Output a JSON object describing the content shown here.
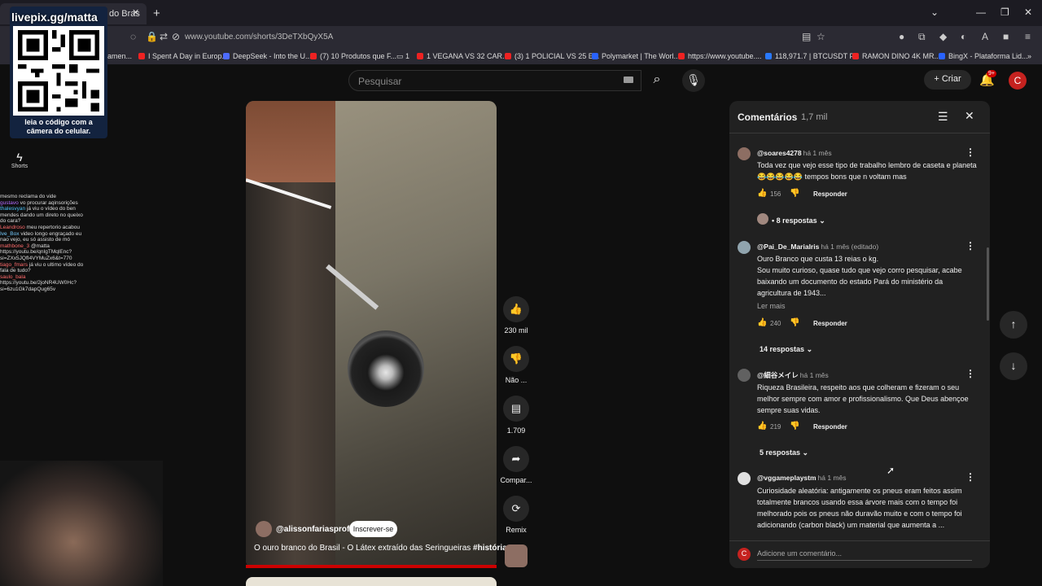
{
  "browser": {
    "tab_title": "do Bras",
    "url": "www.youtube.com/shorts/3DeTXbQyX5A",
    "bookmarks": [
      "amen...",
      "I Spent A Day in Europ...",
      "DeepSeek - Into the U...",
      "(7) 10 Produtos que F...",
      "1",
      "1 VEGANA VS 32 CAR...",
      "(3) 1 POLICIAL VS 25 E...",
      "Polymarket | The Worl...",
      "https://www.youtube....",
      "118,971.7 | BTCUSDT P...",
      "RAMON DINO 4K MR...",
      "BingX - Plataforma Lid..."
    ]
  },
  "overlay": {
    "qr_title": "livepix.gg/matta",
    "qr_caption": "leia o código com a câmera do celular.",
    "shorts_label": "Shorts",
    "chat_lines": [
      {
        "user": "",
        "text": "mesmo reclama do vide"
      },
      {
        "user": "gustavo",
        "text": "vo procurar aqinsorições"
      },
      {
        "user": "thalesvyan",
        "text": "já viu o vídeo do ben mendes dando um direto no queixo do cara?"
      },
      {
        "user": "Leandroso",
        "text": "meu repertorio acabou"
      },
      {
        "user": "Ive_Box",
        "text": "video longo engraçado eu nao vejo, eu só assisto de mó"
      },
      {
        "user": "mathbone_3",
        "text": "@matta https://youtu.be/qnIgTMqlEnc?si=ZXx5JQfI4VYMuZx6&t=770"
      },
      {
        "user": "tiago_fmars",
        "text": "já viu o ultimo vídeo do fala de tudo?"
      },
      {
        "user": "saulo_bala",
        "text": "https://youtu.be/2joNR4UW0Hc?si=6zu1Gk7dapQug65v"
      }
    ]
  },
  "youtube": {
    "search_placeholder": "Pesquisar",
    "create_label": "Criar",
    "notification_badge": "9+",
    "avatar_letter": "C"
  },
  "video": {
    "channel": "@alissonfariasprofe",
    "subscribe_label": "Inscrever-se",
    "title": "O ouro branco do Brasil - O Látex extraído das Seringueiras ",
    "hashtag": "#história",
    "actions": {
      "like_count": "230 mil",
      "dislike_label": "Não ...",
      "comment_count": "1.709",
      "share_label": "Compar...",
      "remix_label": "Remix"
    }
  },
  "comments": {
    "title": "Comentários",
    "count": "1,7 mil",
    "add_placeholder": "Adicione um comentário...",
    "footer_avatar": "C",
    "items": [
      {
        "user": "@soares4278",
        "time": "há 1 mês",
        "text": "Toda vez que vejo esse tipo de trabalho lembro de caseta e planeta 😂😂😂😂😂 tempos bons que n voltam mas",
        "likes": "156",
        "reply_label": "Responder",
        "replies": "• 8 respostas"
      },
      {
        "user": "@Pai_De_MariaIris",
        "time": "há 1 mês (editado)",
        "text": "Ouro Branco que custa 13 reias o kg.\nSou muito curioso, quase tudo que vejo corro pesquisar, acabe baixando um documento do estado Pará do ministério da agricultura de 1943...",
        "read_more": "Ler mais",
        "likes": "240",
        "reply_label": "Responder",
        "replies": "14 respostas"
      },
      {
        "user": "@細谷メイレ",
        "time": "há 1 mês",
        "text": "Riqueza Brasileira, respeito aos que colheram e fizeram o seu melhor sempre com amor e profissionalismo. Que Deus abençoe sempre suas vidas.",
        "likes": "219",
        "reply_label": "Responder",
        "replies": "5 respostas"
      },
      {
        "user": "@vggameplaystm",
        "time": "há 1 mês",
        "text": "Curiosidade aleatória: antigamente os pneus eram feitos assim totalmente brancos usando essa árvore mais com o tempo foi melhorado pois os pneus não duravão muito e com o tempo foi adicionando (carbon black) um material que aumenta a ..."
      }
    ]
  }
}
